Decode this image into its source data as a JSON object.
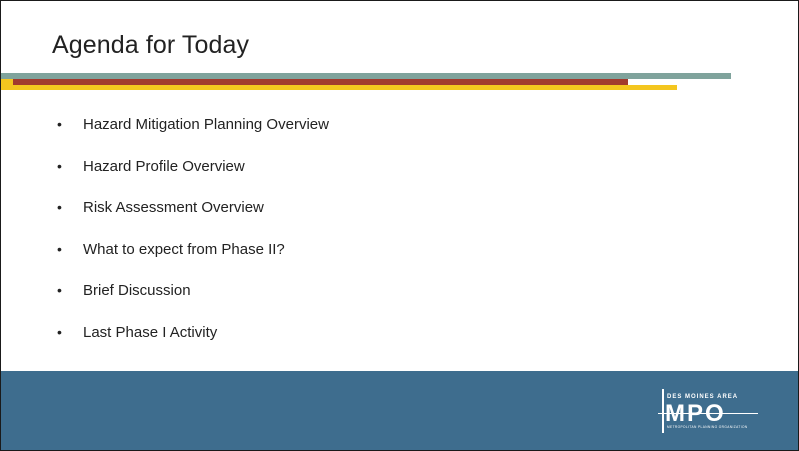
{
  "slide": {
    "title": "Agenda for Today",
    "items": [
      "Hazard Mitigation Planning Overview",
      "Hazard Profile Overview",
      "Risk Assessment Overview",
      "What to expect from Phase II?",
      "Brief Discussion",
      "Last Phase I Activity"
    ],
    "bullet": "•"
  },
  "logo": {
    "top_text": "DES MOINES AREA",
    "main_text": "MPO",
    "tagline": "METROPOLITAN PLANNING ORGANIZATION"
  },
  "colors": {
    "accent_teal": "#7fa39c",
    "accent_red": "#a23a2e",
    "accent_gold": "#f4c61f",
    "footer_blue": "#3e6d8e"
  }
}
